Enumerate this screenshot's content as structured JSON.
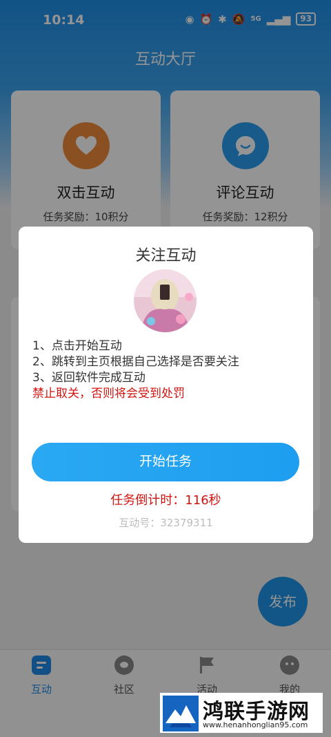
{
  "status_bar": {
    "time": "10:14",
    "network": "5G",
    "battery": "93"
  },
  "page": {
    "title": "互动大厅"
  },
  "cards": [
    {
      "title": "双击互动",
      "reward": "任务奖励：10积分",
      "icon": "heart-icon",
      "color": "#f08a3c"
    },
    {
      "title": "评论互动",
      "reward": "任务奖励：12积分",
      "icon": "comment-icon",
      "color": "#2a9ef0"
    }
  ],
  "fab": {
    "label": "发布"
  },
  "tabs": [
    {
      "label": "互动",
      "icon": "interaction-icon",
      "active": true
    },
    {
      "label": "社区",
      "icon": "community-icon",
      "active": false
    },
    {
      "label": "活动",
      "icon": "flag-icon",
      "active": false
    },
    {
      "label": "我的",
      "icon": "profile-icon",
      "active": false
    }
  ],
  "modal": {
    "title": "关注互动",
    "steps": [
      "1、点击开始互动",
      "2、跳转到主页根据自己选择是否要关注",
      "3、返回软件完成互动"
    ],
    "warning": "禁止取关，否则将会受到处罚",
    "start_button": "开始任务",
    "countdown": "任务倒计时：116秒",
    "interaction_id": "互动号：32379311"
  },
  "watermark": {
    "title": "鸿联手游网",
    "url": "www.henanhonglian95.com"
  },
  "colors": {
    "accent": "#1e9ef0",
    "warning": "#d0140f"
  }
}
